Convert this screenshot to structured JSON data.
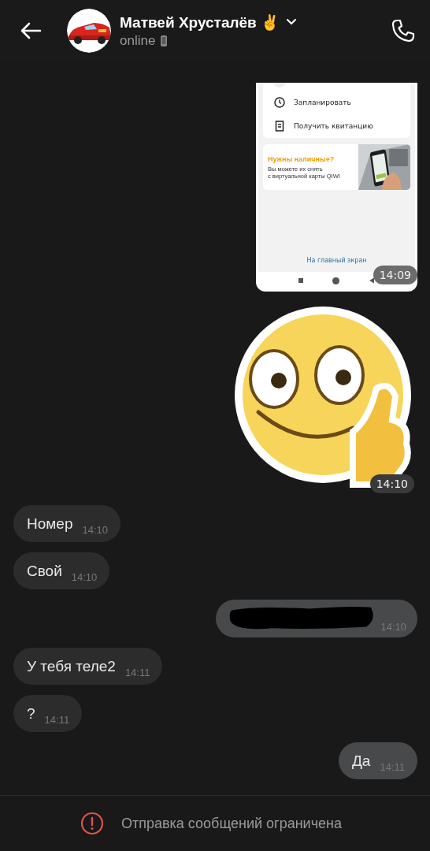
{
  "header": {
    "title": "Матвей Хрусталёв ✌️",
    "status": "online"
  },
  "messages": [
    {
      "kind": "screenshot",
      "outgoing": true,
      "time": "14:09",
      "screen": {
        "menu_items": [
          "Запланировать",
          "Получить квитанцию"
        ],
        "banner_title": "Нужны наличные?",
        "banner_lines": [
          "Вы можете их снять",
          "с виртуальной карты QIWI"
        ],
        "link": "На главный экран"
      }
    },
    {
      "kind": "sticker",
      "outgoing": true,
      "time": "14:10"
    },
    {
      "kind": "text",
      "outgoing": false,
      "text": "Номер",
      "time": "14:10"
    },
    {
      "kind": "text",
      "outgoing": false,
      "text": "Свой",
      "time": "14:10"
    },
    {
      "kind": "redacted",
      "outgoing": true,
      "time": "14:10"
    },
    {
      "kind": "text",
      "outgoing": false,
      "text": "У тебя теле2",
      "time": "14:11"
    },
    {
      "kind": "text",
      "outgoing": false,
      "text": "?",
      "time": "14:11"
    },
    {
      "kind": "text",
      "outgoing": true,
      "text": "Да",
      "time": "14:11"
    }
  ],
  "notice": "Отправка сообщений ограничена"
}
